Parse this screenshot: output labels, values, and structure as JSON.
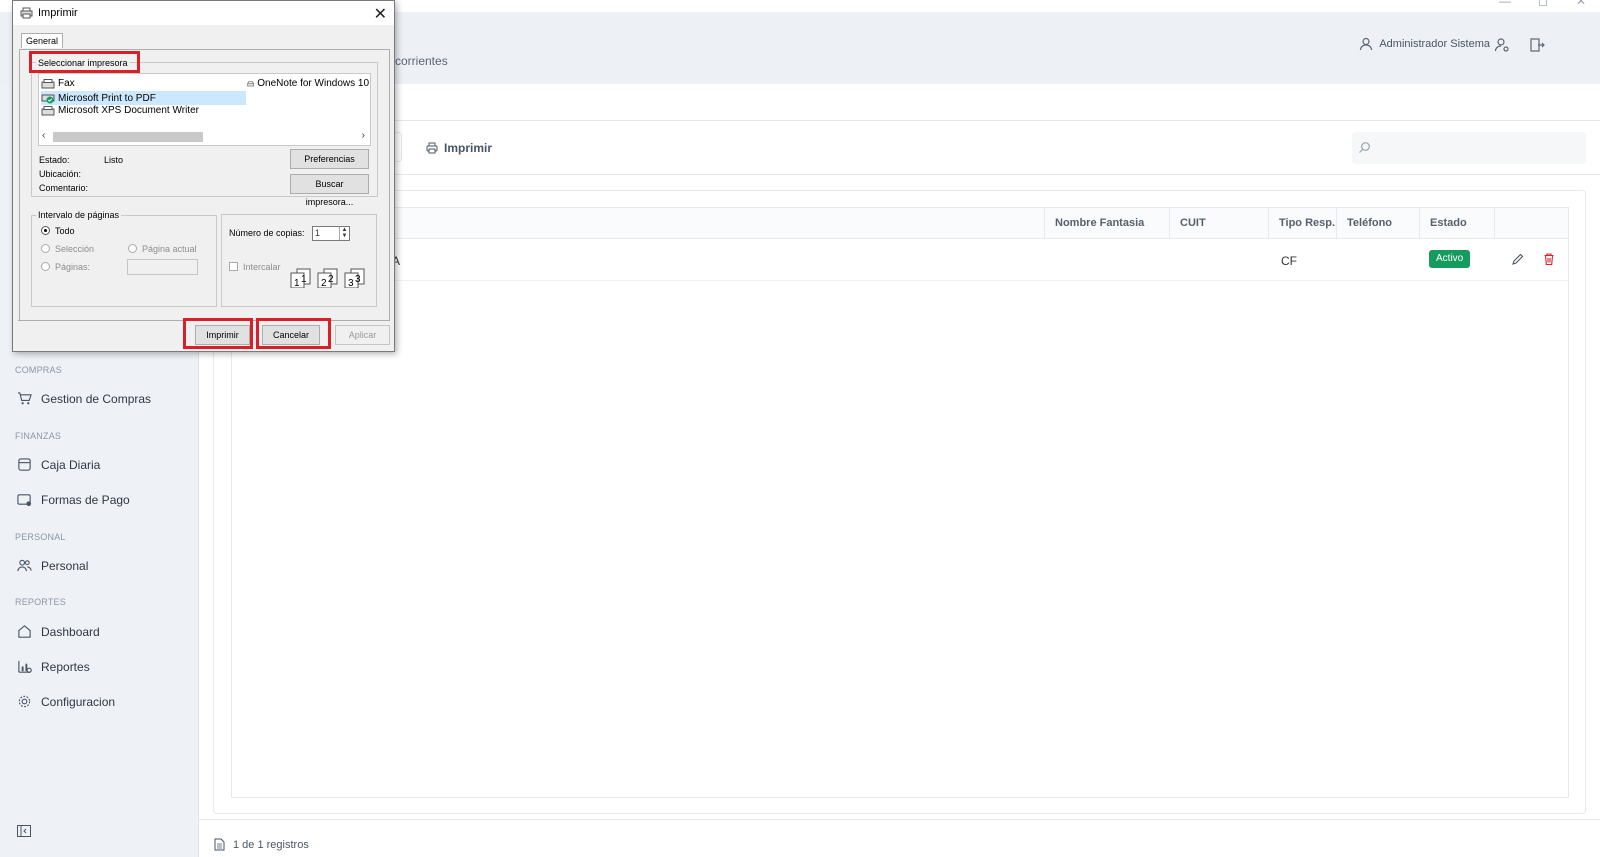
{
  "window_controls": [
    "—",
    "◻",
    "✕"
  ],
  "header": {
    "breadcrumb_partial": "corrientes",
    "user_name": "Administrador Sistema"
  },
  "sidebar": {
    "sections": [
      {
        "label": "COMPRAS",
        "items": [
          {
            "label": "Gestion de Compras",
            "icon": "cart-icon"
          }
        ]
      },
      {
        "label": "FINANZAS",
        "items": [
          {
            "label": "Caja Diaria",
            "icon": "cash-box-icon"
          },
          {
            "label": "Formas de Pago",
            "icon": "payment-card-icon"
          }
        ]
      },
      {
        "label": "PERSONAL",
        "items": [
          {
            "label": "Personal",
            "icon": "users-icon"
          }
        ]
      },
      {
        "label": "REPORTES",
        "items": [
          {
            "label": "Dashboard",
            "icon": "home-icon"
          },
          {
            "label": "Reportes",
            "icon": "chart-icon"
          },
          {
            "label": "Configuracion",
            "icon": "gear-icon"
          }
        ]
      }
    ]
  },
  "toolbar": {
    "print_label": "Imprimir",
    "search_placeholder": ""
  },
  "table": {
    "columns": [
      "Nombre Fantasia",
      "CUIT",
      "Tipo Resp.",
      "Teléfono",
      "Estado"
    ],
    "rows": [
      {
        "name_partial": "A",
        "nombre_fantasia": "",
        "cuit": "",
        "tipo_resp": "CF",
        "telefono": "",
        "estado": "Activo"
      }
    ],
    "status_color": "#169b5e"
  },
  "footer": {
    "records_text": "1 de 1 registros"
  },
  "print_dialog": {
    "title": "Imprimir",
    "tab": "General",
    "select_printer_label": "Seleccionar impresora",
    "printers": [
      {
        "name": "Fax",
        "selected": false
      },
      {
        "name": "Microsoft Print to PDF",
        "selected": true
      },
      {
        "name": "Microsoft XPS Document Writer",
        "selected": false
      },
      {
        "name": "OneNote for Windows 10",
        "selected": false
      }
    ],
    "status_label": "Estado:",
    "status_value": "Listo",
    "location_label": "Ubicación:",
    "comment_label": "Comentario:",
    "preferences_button": "Preferencias",
    "find_printer_button": "Buscar impresora...",
    "page_range_label": "Intervalo de páginas",
    "range_all": "Todo",
    "range_selection": "Selección",
    "range_current": "Página actual",
    "range_pages": "Páginas:",
    "copies_label": "Número de copias:",
    "copies_value": "1",
    "collate_label": "Intercalar",
    "print_button": "Imprimir",
    "cancel_button": "Cancelar",
    "apply_button": "Aplicar",
    "highlight_color": "#d8202a"
  }
}
